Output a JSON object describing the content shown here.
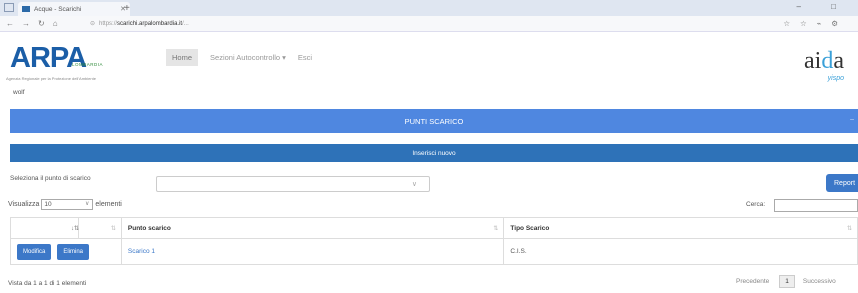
{
  "browser": {
    "tab_title": "Acque - Scarichi",
    "url_host": "scarichi.arpalombardia.it",
    "url_rest": "/...",
    "new_tab": "+",
    "tab_close": "✕",
    "window_controls": "– □"
  },
  "header": {
    "logo_text": "ARPA",
    "logo_region": "LOMBARDIA",
    "logo_subtitle": "Agenzia Regionale per la Protezione dell'Ambiente",
    "user": "wolf",
    "menu": {
      "home": "Home",
      "sections": "Sezioni Autocontrollo",
      "sections_caret": "▾",
      "exit": "Esci"
    },
    "aida_left": "ai",
    "aida_d": "d",
    "aida_right": "a",
    "aida_sub": "yispo"
  },
  "panel": {
    "title": "PUNTI SCARICO",
    "collapse": "–",
    "insert_label": "Inserisci nuovo"
  },
  "selector": {
    "label": "Seleziona il punto di scarico",
    "value": "",
    "chevron": "∨",
    "report_label": "Report"
  },
  "table_controls": {
    "show_label": "Visualizza",
    "page_length": "10",
    "elements_label": "elementi",
    "search_label": "Cerca:",
    "search_value": ""
  },
  "table": {
    "columns": [
      "",
      "",
      "Punto scarico",
      "Tipo Scarico"
    ],
    "rows": [
      {
        "edit": "Modifica",
        "delete": "Elimina",
        "punto": "Scarico 1",
        "tipo": "C.I.S."
      }
    ]
  },
  "footer": {
    "info": "Vista da 1 a 1 di 1 elementi",
    "previous": "Precedente",
    "page": "1",
    "next": "Successivo"
  },
  "colors": {
    "title_bar": "#4f87e0",
    "insert_bar": "#2e72b8",
    "button": "#3c78c8"
  }
}
